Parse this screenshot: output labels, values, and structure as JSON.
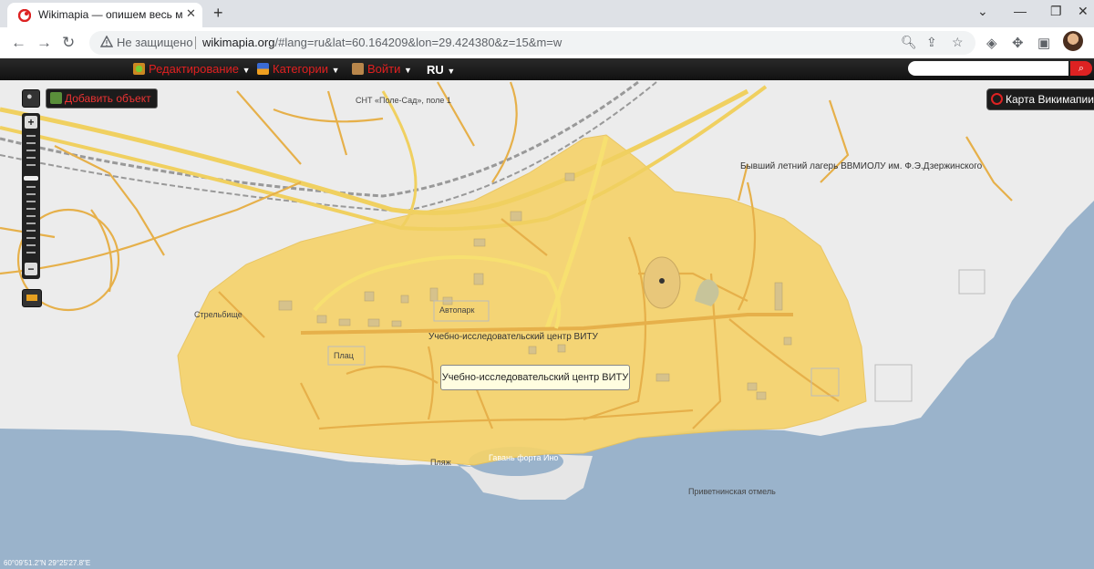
{
  "browser": {
    "tab_title": "Wikimapia — опишем весь мир!",
    "security_label": "Не защищено",
    "url_host": "wikimapia.org",
    "url_rest": "/#lang=ru&lat=60.164209&lon=29.424380&z=15&m=w"
  },
  "wm": {
    "menu_edit": "Редактирование",
    "menu_categories": "Категории",
    "menu_login": "Войти",
    "lang": "RU",
    "add_object": "Добавить объект",
    "wm_map": "Карта Викимапии"
  },
  "map": {
    "labels": {
      "snt": "СНТ «Поле-Сад», поле 1",
      "camp": "Бывший летний лагерь ВВМИОЛУ им. Ф.Э.Дзержинского",
      "shooting": "Стрельбище",
      "autopark": "Автопарк",
      "center": "Учебно-исследовательский центр ВИТУ",
      "plac": "Плац",
      "harbor": "Гавань форта Ино",
      "beach": "Пляж",
      "shoal": "Приветнинская отмель"
    },
    "tooltip": "Учебно-исследовательский центр ВИТУ",
    "coordinates": "60°09'51.2\"N 29°25'27.8\"E",
    "colors": {
      "water": "#9ab3cb",
      "land": "#ececec",
      "area": "#f5d36b",
      "road": "#e6b04a"
    }
  }
}
